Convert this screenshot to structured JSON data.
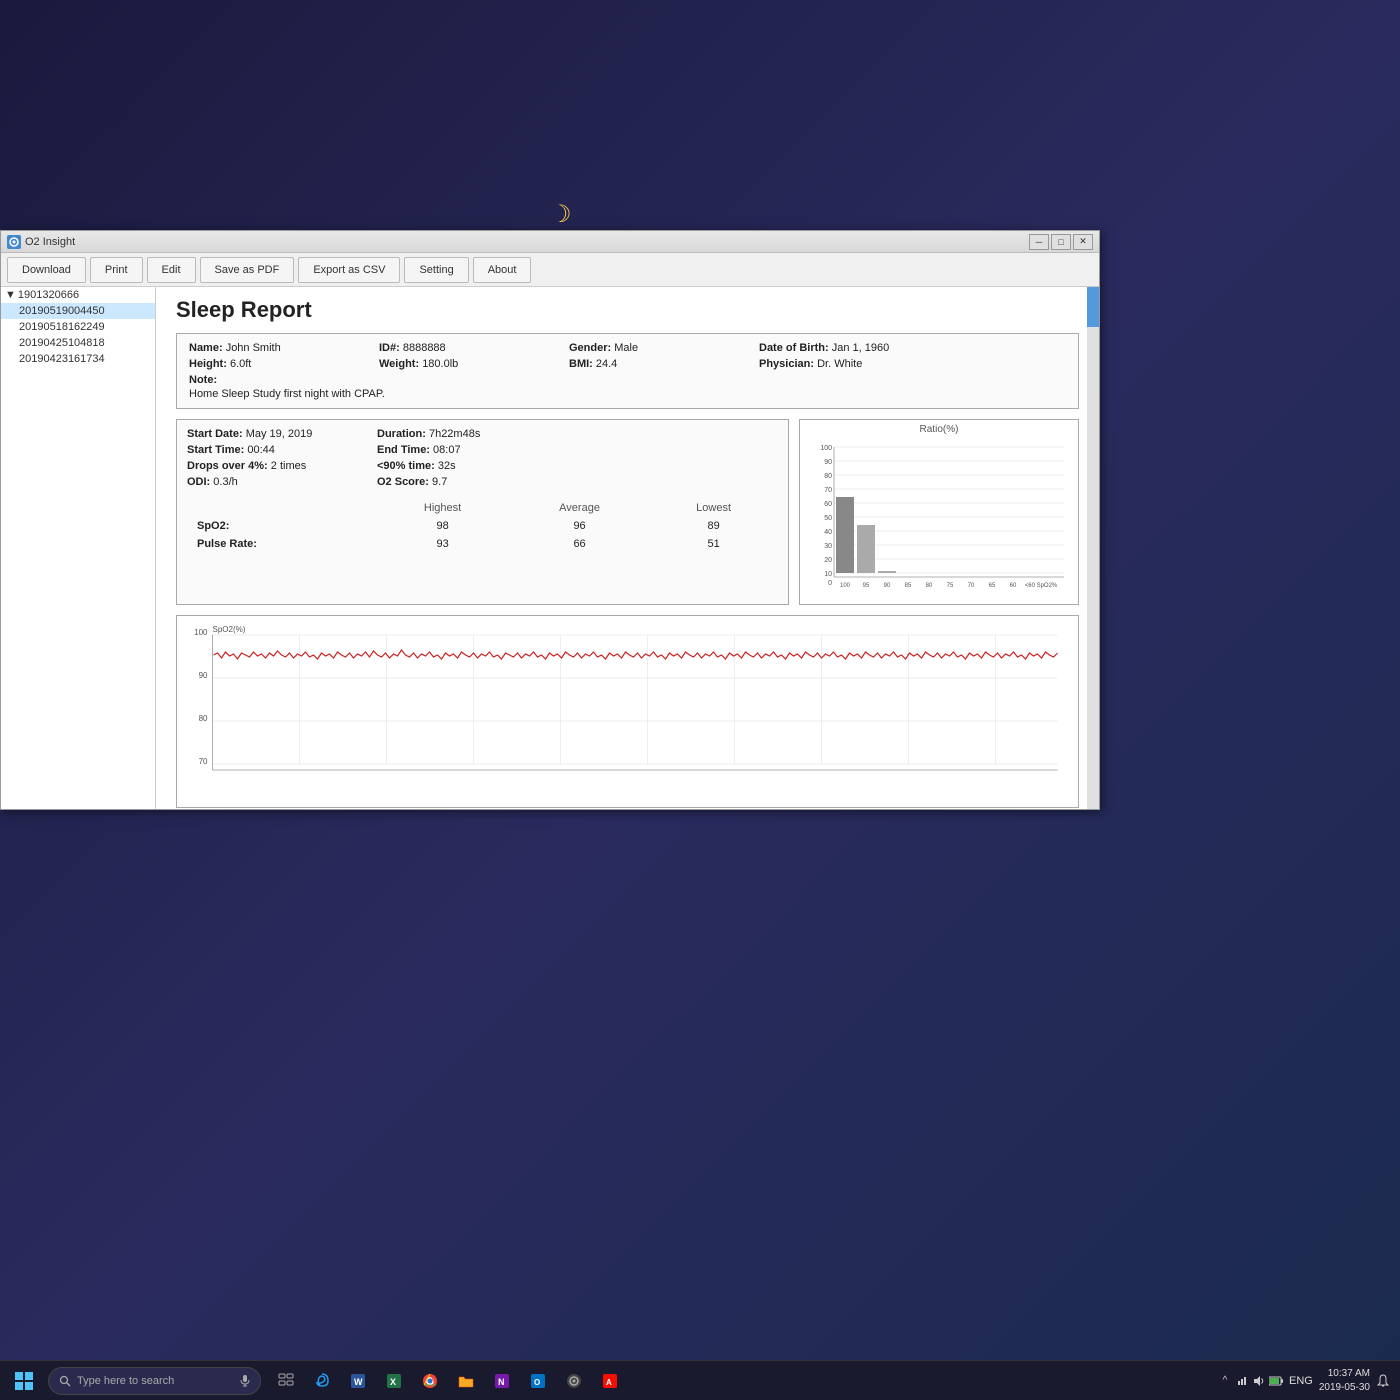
{
  "window": {
    "title": "O2 Insight",
    "icon_color": "#4488cc"
  },
  "toolbar": {
    "buttons": [
      "Download",
      "Print",
      "Edit",
      "Save as PDF",
      "Export as CSV",
      "Setting",
      "About"
    ]
  },
  "sidebar": {
    "root_item": "1901320666",
    "items": [
      "20190519004450",
      "20190518162249",
      "20190425104818",
      "20190423161734"
    ]
  },
  "report": {
    "title": "Sleep Report",
    "patient": {
      "name_label": "Name:",
      "name": "John Smith",
      "id_label": "ID#:",
      "id": "8888888",
      "gender_label": "Gender:",
      "gender": "Male",
      "dob_label": "Date of Birth:",
      "dob": "Jan 1, 1960",
      "height_label": "Height:",
      "height": "6.0ft",
      "weight_label": "Weight:",
      "weight": "180.0lb",
      "bmi_label": "BMI:",
      "bmi": "24.4",
      "physician_label": "Physician:",
      "physician": "Dr. White",
      "note_label": "Note:",
      "note": "Home Sleep Study first night with CPAP."
    },
    "stats": {
      "start_date_label": "Start Date:",
      "start_date": "May 19, 2019",
      "duration_label": "Duration:",
      "duration": "7h22m48s",
      "start_time_label": "Start Time:",
      "start_time": "00:44",
      "end_time_label": "End Time:",
      "end_time": "08:07",
      "drops_label": "Drops over 4%:",
      "drops": "2 times",
      "lt90_label": "<90% time:",
      "lt90": "32s",
      "odi_label": "ODI:",
      "odi": "0.3/h",
      "o2score_label": "O2 Score:",
      "o2score": "9.7"
    },
    "measurements": {
      "headers": [
        "",
        "Highest",
        "Average",
        "Lowest"
      ],
      "rows": [
        [
          "SpO2:",
          "98",
          "96",
          "89"
        ],
        [
          "Pulse Rate:",
          "93",
          "66",
          "51"
        ]
      ]
    },
    "bar_chart": {
      "title": "Ratio(%)",
      "y_labels": [
        100,
        90,
        80,
        70,
        60,
        50,
        40,
        30,
        20,
        10,
        0
      ],
      "x_labels": [
        "100",
        "95",
        "90",
        "85",
        "80",
        "75",
        "70",
        "65",
        "60",
        "<60 SpO2%"
      ],
      "bars": [
        {
          "x_label": "100",
          "height_pct": 60
        },
        {
          "x_label": "95",
          "height_pct": 38
        },
        {
          "x_label": "90",
          "height_pct": 2
        },
        {
          "x_label": "85",
          "height_pct": 0
        },
        {
          "x_label": "80",
          "height_pct": 0
        },
        {
          "x_label": "75",
          "height_pct": 0
        },
        {
          "x_label": "70",
          "height_pct": 0
        },
        {
          "x_label": "65",
          "height_pct": 0
        },
        {
          "x_label": "60",
          "height_pct": 0
        },
        {
          "x_label": "<60",
          "height_pct": 0
        }
      ]
    },
    "spo2_chart": {
      "title": "SpO2(%)",
      "y_min": 70,
      "y_max": 100,
      "y_labels": [
        100,
        90,
        80,
        70
      ]
    }
  },
  "taskbar": {
    "search_placeholder": "Type here to search",
    "time": "10:37 AM",
    "date": "2019-05-30",
    "language": "ENG"
  }
}
